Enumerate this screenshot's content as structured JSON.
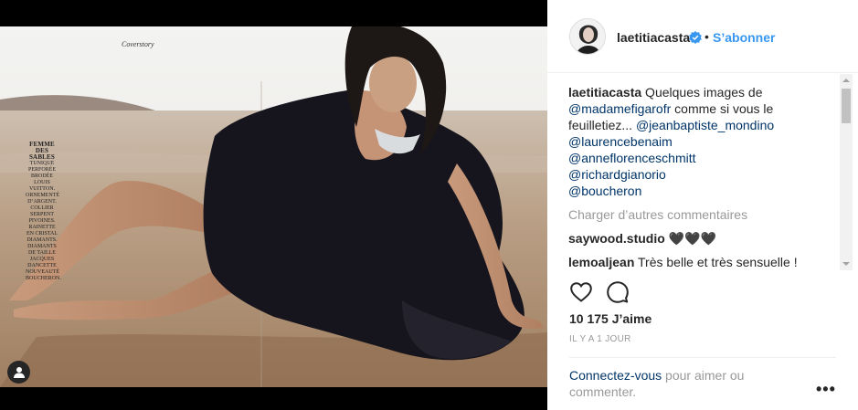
{
  "photo": {
    "magazine_section": "Coverstory",
    "sidebar_title": "FEMME DES SABLES",
    "sidebar_text": "TUNIQUE PERFORÉE BRODÉE LOUIS VUITTON. ORNEMENTÉ D’ARGENT. COLLIER SERPENT PIVOINES. RAINETTE EN CRISTAL DIAMANTS. DIAMANTS DE TAILLE JACQUES DANCETTE NOUVEAUTÉ BOUCHERON.",
    "icons": {
      "user_tag": "user-tag-icon"
    }
  },
  "header": {
    "username": "laetitiacasta",
    "separator": "•",
    "follow_label": "S’abonner",
    "icons": {
      "verified": "verified-badge-icon",
      "avatar": "avatar"
    }
  },
  "caption": {
    "author": "laetitiacasta",
    "text_1": " Quelques images de ",
    "mention_1": "@madamefigarofr",
    "text_2": " comme si vous le feuilletiez... ",
    "mention_2": "@jeanbaptiste_mondino",
    "mention_3": "@laurencebenaim",
    "mention_4": "@anneflorenceschmitt",
    "mention_5": "@richardgianorio",
    "mention_6": "@boucheron"
  },
  "load_more_label": "Charger d’autres commentaires",
  "comments": [
    {
      "user": "saywood.studio",
      "text": "🖤🖤🖤"
    },
    {
      "user": "lemoaljean",
      "text": "Très belle et très sensuelle !"
    }
  ],
  "actions": {
    "like": "heart-icon",
    "comment": "comment-icon"
  },
  "likes_text": "10 175 J’aime",
  "time_text": "IL Y A 1 JOUR",
  "login": {
    "link": "Connectez-vous",
    "rest": " pour aimer ou commenter."
  },
  "more_label": "•••",
  "colors": {
    "link_blue": "#3897f0",
    "mention_navy": "#003569",
    "muted": "#999999",
    "text": "#262626"
  }
}
